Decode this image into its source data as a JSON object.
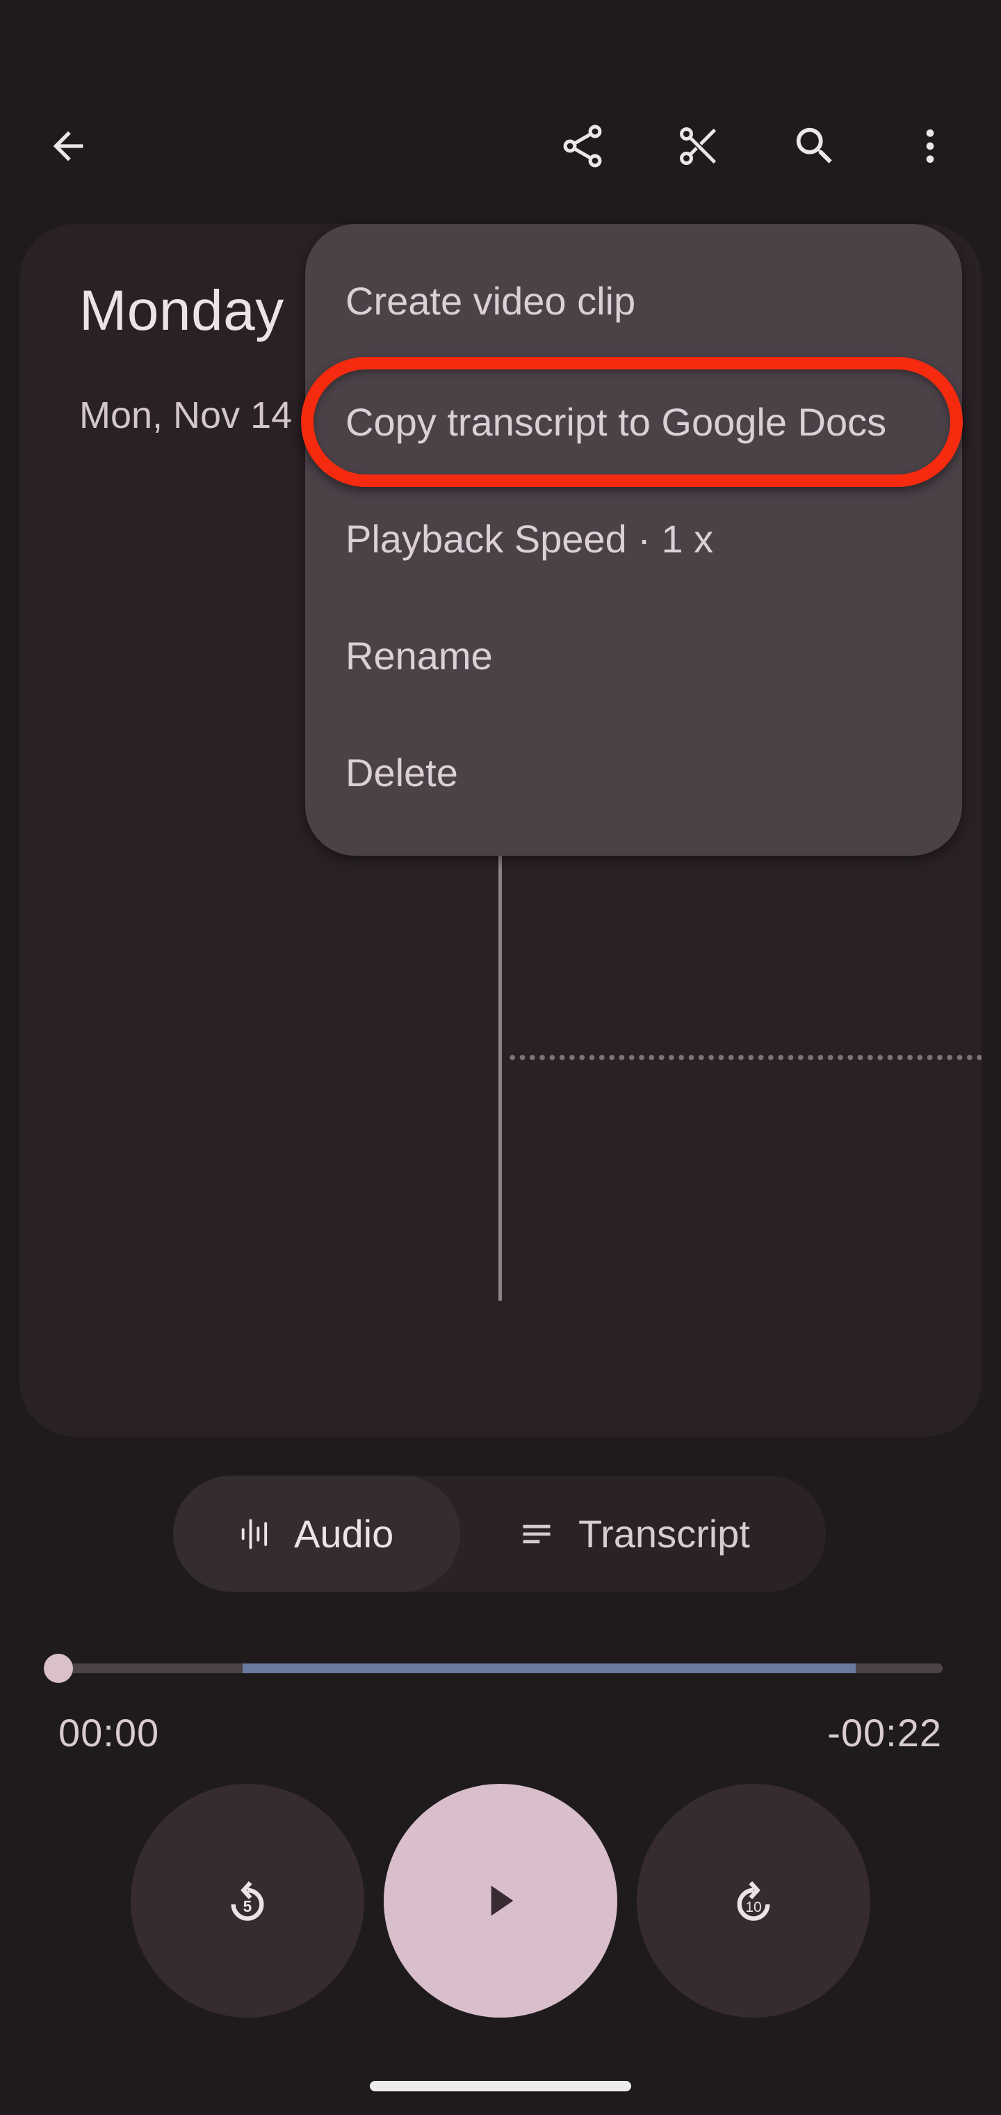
{
  "app_bar": {
    "back_icon": "arrow-back-icon",
    "actions": [
      {
        "name": "share",
        "icon": "share-icon"
      },
      {
        "name": "clip",
        "icon": "scissors-icon"
      },
      {
        "name": "search",
        "icon": "search-icon"
      },
      {
        "name": "more",
        "icon": "more-vertical-icon"
      }
    ]
  },
  "recording": {
    "title": "Monday",
    "date": "Mon, Nov 14"
  },
  "overflow_menu": {
    "items": [
      {
        "label": "Create video clip"
      },
      {
        "label": "Copy transcript to Google Docs",
        "highlighted": true
      },
      {
        "label": "Playback Speed · 1 x"
      },
      {
        "label": "Rename"
      },
      {
        "label": "Delete"
      }
    ],
    "highlight_color": "#f62a0e"
  },
  "view_toggle": {
    "selected": "Audio",
    "options": [
      {
        "label": "Audio",
        "icon": "audio-waveform-icon"
      },
      {
        "label": "Transcript",
        "icon": "transcript-lines-icon"
      }
    ]
  },
  "player": {
    "elapsed": "00:00",
    "remaining": "-00:22",
    "position_fraction": 0.0,
    "highlighted_range_fraction": [
      0.217,
      0.903
    ],
    "rewind_seconds": "5",
    "forward_seconds": "10",
    "state": "paused"
  },
  "colors": {
    "background": "#1f1b1d",
    "card": "#2a2126",
    "menu": "#4b4248",
    "accent_play": "#d9bfcb",
    "range": "#6b7aa0"
  }
}
